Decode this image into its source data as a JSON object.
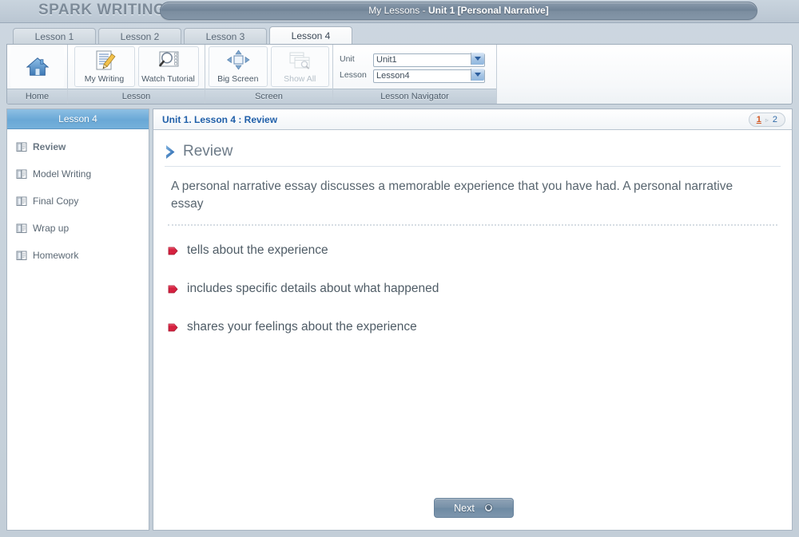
{
  "window": {
    "logo": "SPARK WRITING",
    "title_prefix": "My Lessons - ",
    "title_strong": "Unit 1 [Personal Narrative]"
  },
  "tabs": [
    {
      "label": "Lesson 1",
      "active": false
    },
    {
      "label": "Lesson 2",
      "active": false
    },
    {
      "label": "Lesson 3",
      "active": false
    },
    {
      "label": "Lesson 4",
      "active": true
    }
  ],
  "ribbon": {
    "groups": [
      {
        "label": "Home",
        "buttons": [
          {
            "label": "",
            "icon": "home-icon",
            "disabled": false
          }
        ]
      },
      {
        "label": "Lesson",
        "buttons": [
          {
            "label": "My Writing",
            "icon": "pencil-document-icon",
            "disabled": false
          },
          {
            "label": "Watch Tutorial",
            "icon": "magnifier-film-icon",
            "disabled": false
          }
        ]
      },
      {
        "label": "Screen",
        "buttons": [
          {
            "label": "Big Screen",
            "icon": "expand-arrows-icon",
            "disabled": false
          },
          {
            "label": "Show All",
            "icon": "windows-search-icon",
            "disabled": true
          }
        ]
      },
      {
        "label": "Lesson Navigator",
        "buttons": []
      }
    ],
    "navigator": {
      "unit_label": "Unit",
      "unit_value": "Unit1",
      "unit_options": [
        "Unit1"
      ],
      "lesson_label": "Lesson",
      "lesson_value": "Lesson4",
      "lesson_options": [
        "Lesson4"
      ],
      "group_label": "Lesson Navigator"
    }
  },
  "sidebar": {
    "header": "Lesson 4",
    "items": [
      {
        "label": "Review",
        "icon": "book-icon",
        "selected": true
      },
      {
        "label": "Model Writing",
        "icon": "book-icon",
        "selected": false
      },
      {
        "label": "Final Copy",
        "icon": "book-icon",
        "selected": false
      },
      {
        "label": "Wrap up",
        "icon": "book-icon",
        "selected": false
      },
      {
        "label": "Homework",
        "icon": "book-icon",
        "selected": false
      }
    ]
  },
  "content": {
    "breadcrumb": "Unit 1. Lesson 4 : Review",
    "pager": {
      "pages": [
        "1",
        "2"
      ],
      "current": "1",
      "separator": "▹"
    },
    "section_title": "Review",
    "paragraph": "A personal narrative essay discusses a memorable experience that you have had. A personal narrative essay",
    "bullets": [
      "tells about the experience",
      "includes specific details about what happened",
      "shares your feelings about the experience"
    ],
    "next_label": "Next"
  },
  "colors": {
    "accent_blue": "#1f5fa9",
    "sidebar_header": "#6aa8d6",
    "pager_current": "#d2551f",
    "bullet_red": "#d5213f",
    "title_bar": "#7b8d9f"
  }
}
